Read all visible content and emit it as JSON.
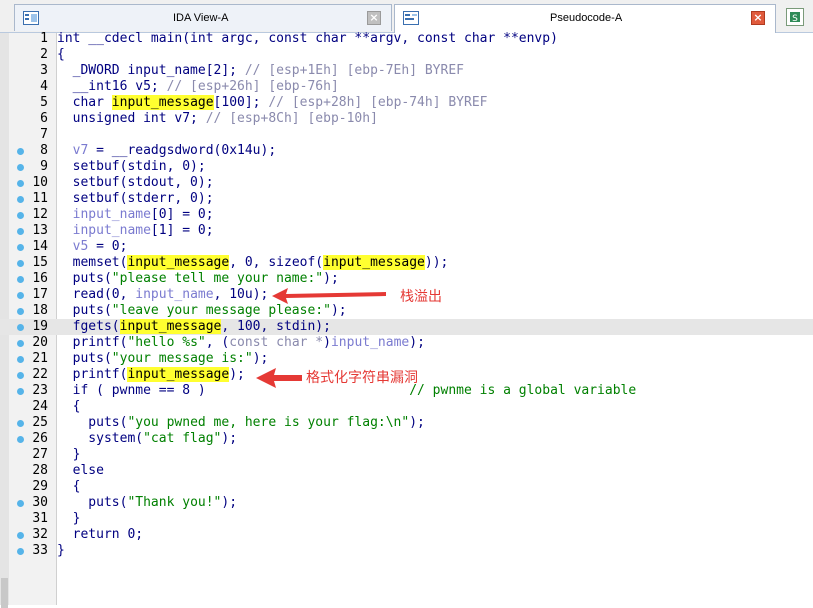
{
  "tabs": [
    {
      "label": "IDA View-A",
      "active": false
    },
    {
      "label": "Pseudocode-A",
      "active": true
    }
  ],
  "lines": [
    {
      "n": "1",
      "bp": false,
      "hl": false,
      "segs": [
        [
          "k",
          "int __cdecl main(int argc, const char **argv, const char **envp)"
        ]
      ]
    },
    {
      "n": "2",
      "bp": false,
      "hl": false,
      "segs": [
        [
          "k",
          "{"
        ]
      ]
    },
    {
      "n": "3",
      "bp": false,
      "hl": false,
      "segs": [
        [
          "k",
          "  _DWORD input_name[2]; "
        ],
        [
          "c",
          "// [esp+1Eh] [ebp-7Eh] BYREF"
        ]
      ]
    },
    {
      "n": "4",
      "bp": false,
      "hl": false,
      "segs": [
        [
          "k",
          "  __int16 v5; "
        ],
        [
          "c",
          "// [esp+26h] [ebp-76h]"
        ]
      ]
    },
    {
      "n": "5",
      "bp": false,
      "hl": false,
      "segs": [
        [
          "k",
          "  char "
        ],
        [
          "y",
          "input_message"
        ],
        [
          "k",
          "[100]; "
        ],
        [
          "c",
          "// [esp+28h] [ebp-74h] BYREF"
        ]
      ]
    },
    {
      "n": "6",
      "bp": false,
      "hl": false,
      "segs": [
        [
          "k",
          "  unsigned int v7; "
        ],
        [
          "c",
          "// [esp+8Ch] [ebp-10h]"
        ]
      ]
    },
    {
      "n": "7",
      "bp": false,
      "hl": false,
      "segs": []
    },
    {
      "n": "8",
      "bp": true,
      "hl": false,
      "segs": [
        [
          "v",
          "  v7"
        ],
        [
          "k",
          " = __readgsdword(0x14u);"
        ]
      ]
    },
    {
      "n": "9",
      "bp": true,
      "hl": false,
      "segs": [
        [
          "k",
          "  setbuf(stdin, 0);"
        ]
      ]
    },
    {
      "n": "10",
      "bp": true,
      "hl": false,
      "segs": [
        [
          "k",
          "  setbuf(stdout, 0);"
        ]
      ]
    },
    {
      "n": "11",
      "bp": true,
      "hl": false,
      "segs": [
        [
          "k",
          "  setbuf(stderr, 0);"
        ]
      ]
    },
    {
      "n": "12",
      "bp": true,
      "hl": false,
      "segs": [
        [
          "v",
          "  input_name"
        ],
        [
          "k",
          "[0] = 0;"
        ]
      ]
    },
    {
      "n": "13",
      "bp": true,
      "hl": false,
      "segs": [
        [
          "v",
          "  input_name"
        ],
        [
          "k",
          "[1] = 0;"
        ]
      ]
    },
    {
      "n": "14",
      "bp": true,
      "hl": false,
      "segs": [
        [
          "v",
          "  v5"
        ],
        [
          "k",
          " = 0;"
        ]
      ]
    },
    {
      "n": "15",
      "bp": true,
      "hl": false,
      "segs": [
        [
          "k",
          "  memset("
        ],
        [
          "y",
          "input_message"
        ],
        [
          "k",
          ", 0, sizeof("
        ],
        [
          "y",
          "input_message"
        ],
        [
          "k",
          "));"
        ]
      ]
    },
    {
      "n": "16",
      "bp": true,
      "hl": false,
      "segs": [
        [
          "k",
          "  puts("
        ],
        [
          "s",
          "\"please tell me your name:\""
        ],
        [
          "k",
          ");"
        ]
      ]
    },
    {
      "n": "17",
      "bp": true,
      "hl": false,
      "segs": [
        [
          "k",
          "  read(0, "
        ],
        [
          "v",
          "input_name"
        ],
        [
          "k",
          ", 10u);"
        ]
      ]
    },
    {
      "n": "18",
      "bp": true,
      "hl": false,
      "segs": [
        [
          "k",
          "  puts("
        ],
        [
          "s",
          "\"leave your message please:\""
        ],
        [
          "k",
          ");"
        ]
      ]
    },
    {
      "n": "19",
      "bp": true,
      "hl": true,
      "segs": [
        [
          "k",
          "  fgets("
        ],
        [
          "y",
          "input_message"
        ],
        [
          "k",
          ", 100, stdin);"
        ]
      ]
    },
    {
      "n": "20",
      "bp": true,
      "hl": false,
      "segs": [
        [
          "k",
          "  printf("
        ],
        [
          "s",
          "\"hello %s\""
        ],
        [
          "k",
          ", ("
        ],
        [
          "c",
          "const char *"
        ],
        [
          "k",
          ")"
        ],
        [
          "v",
          "input_name"
        ],
        [
          "k",
          ");"
        ]
      ]
    },
    {
      "n": "21",
      "bp": true,
      "hl": false,
      "segs": [
        [
          "k",
          "  puts("
        ],
        [
          "s",
          "\"your message is:\""
        ],
        [
          "k",
          ");"
        ]
      ]
    },
    {
      "n": "22",
      "bp": true,
      "hl": false,
      "segs": [
        [
          "k",
          "  printf("
        ],
        [
          "y",
          "input_message"
        ],
        [
          "k",
          ");"
        ]
      ]
    },
    {
      "n": "23",
      "bp": true,
      "hl": false,
      "segs": [
        [
          "k",
          "  if ( pwnme == 8 )                          "
        ],
        [
          "cm",
          "// pwnme is a global variable"
        ]
      ]
    },
    {
      "n": "24",
      "bp": false,
      "hl": false,
      "segs": [
        [
          "k",
          "  {"
        ]
      ]
    },
    {
      "n": "25",
      "bp": true,
      "hl": false,
      "segs": [
        [
          "k",
          "    puts("
        ],
        [
          "s",
          "\"you pwned me, here is your flag:\\n\""
        ],
        [
          "k",
          ");"
        ]
      ]
    },
    {
      "n": "26",
      "bp": true,
      "hl": false,
      "segs": [
        [
          "k",
          "    system("
        ],
        [
          "s",
          "\"cat flag\""
        ],
        [
          "k",
          ");"
        ]
      ]
    },
    {
      "n": "27",
      "bp": false,
      "hl": false,
      "segs": [
        [
          "k",
          "  }"
        ]
      ]
    },
    {
      "n": "28",
      "bp": false,
      "hl": false,
      "segs": [
        [
          "k",
          "  else"
        ]
      ]
    },
    {
      "n": "29",
      "bp": false,
      "hl": false,
      "segs": [
        [
          "k",
          "  {"
        ]
      ]
    },
    {
      "n": "30",
      "bp": true,
      "hl": false,
      "segs": [
        [
          "k",
          "    puts("
        ],
        [
          "s",
          "\"Thank you!\""
        ],
        [
          "k",
          ");"
        ]
      ]
    },
    {
      "n": "31",
      "bp": false,
      "hl": false,
      "segs": [
        [
          "k",
          "  }"
        ]
      ]
    },
    {
      "n": "32",
      "bp": true,
      "hl": false,
      "segs": [
        [
          "k",
          "  return 0;"
        ]
      ]
    },
    {
      "n": "33",
      "bp": true,
      "hl": false,
      "segs": [
        [
          "k",
          "}"
        ]
      ]
    }
  ],
  "annotations": {
    "stack_overflow": "栈溢出",
    "format_string": "格式化字符串漏洞"
  },
  "colors": {
    "keyword": "#000080",
    "comment": "#8a8aad",
    "string": "#008000",
    "variable": "#7b7bd0",
    "highlight": "#ffff30",
    "annotation": "#e53935",
    "breakpoint": "#56b4e9"
  },
  "icons": {
    "ida_view_tab": "ida-view-icon",
    "pseudocode_tab": "pseudocode-icon",
    "close_inactive": "close-icon",
    "close_active": "close-icon",
    "sync": "sync-icon"
  }
}
